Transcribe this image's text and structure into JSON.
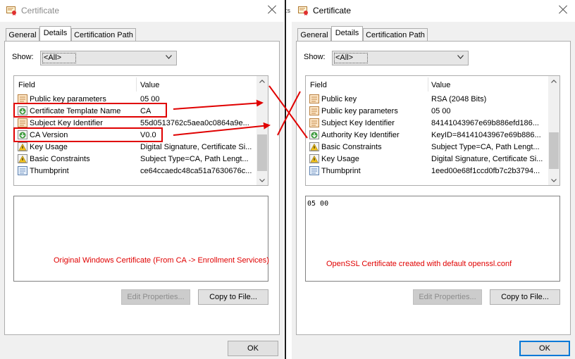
{
  "left": {
    "title": "Certificate",
    "tabs": [
      "General",
      "Details",
      "Certification Path"
    ],
    "show_label": "Show:",
    "show_value": "<All>",
    "columns": {
      "field": "Field",
      "value": "Value"
    },
    "rows": [
      {
        "field": "Public key parameters",
        "value": "05 00",
        "icon": "cert-field-icon"
      },
      {
        "field": "Certificate Template Name",
        "value": "CA",
        "icon": "cert-extension-icon"
      },
      {
        "field": "Subject Key Identifier",
        "value": "55d0513762c5aea0c0864a9e...",
        "icon": "cert-field-icon"
      },
      {
        "field": "CA Version",
        "value": "V0.0",
        "icon": "cert-extension-icon"
      },
      {
        "field": "Key Usage",
        "value": "Digital Signature, Certificate Si...",
        "icon": "cert-critical-extension-icon"
      },
      {
        "field": "Basic Constraints",
        "value": "Subject Type=CA, Path Lengt...",
        "icon": "cert-critical-extension-icon"
      },
      {
        "field": "Thumbprint",
        "value": "ce64ccaedc48ca51a7630676c...",
        "icon": "cert-property-icon"
      }
    ],
    "detail_text": "",
    "annotation": "Original Windows Certificate (From CA -> Enrollment Services)",
    "edit_properties": "Edit Properties...",
    "copy_to_file": "Copy to File...",
    "ok": "OK"
  },
  "right": {
    "title": "Certificate",
    "tabs": [
      "General",
      "Details",
      "Certification Path"
    ],
    "show_label": "Show:",
    "show_value": "<All>",
    "columns": {
      "field": "Field",
      "value": "Value"
    },
    "rows": [
      {
        "field": "Public key",
        "value": "RSA (2048 Bits)",
        "icon": "cert-field-icon"
      },
      {
        "field": "Public key parameters",
        "value": "05 00",
        "icon": "cert-field-icon"
      },
      {
        "field": "Subject Key Identifier",
        "value": "84141043967e69b886efd186...",
        "icon": "cert-field-icon"
      },
      {
        "field": "Authority Key Identifier",
        "value": "KeyID=84141043967e69b886...",
        "icon": "cert-extension-icon"
      },
      {
        "field": "Basic Constraints",
        "value": "Subject Type=CA, Path Lengt...",
        "icon": "cert-critical-extension-icon"
      },
      {
        "field": "Key Usage",
        "value": "Digital Signature, Certificate Si...",
        "icon": "cert-critical-extension-icon"
      },
      {
        "field": "Thumbprint",
        "value": "1eed00e68f1ccd0fb7c2b3794...",
        "icon": "cert-property-icon"
      }
    ],
    "detail_text": "05 00",
    "annotation": "OpenSSL Certificate created with default openssl.conf",
    "edit_properties": "Edit Properties...",
    "copy_to_file": "Copy to File...",
    "ok": "OK"
  },
  "separator_text": ":s",
  "colors": {
    "annotation": "#e00000",
    "focus_blue": "#0078d7",
    "window_bg": "#f0f0f0"
  }
}
